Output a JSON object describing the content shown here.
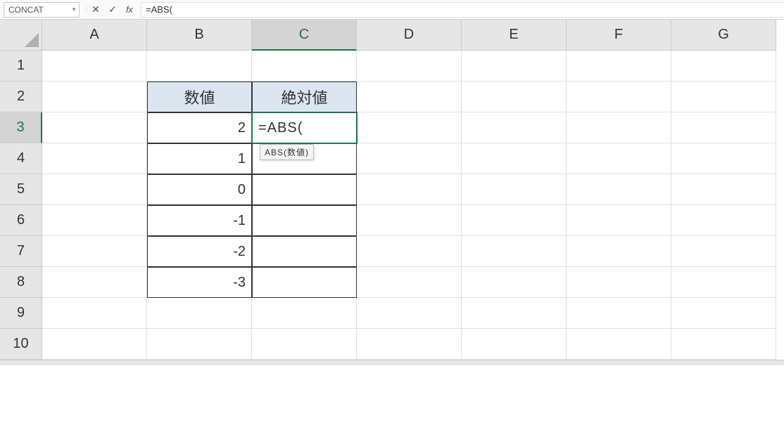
{
  "formula_bar": {
    "name_box": "CONCAT",
    "cancel_icon": "✕",
    "enter_icon": "✓",
    "fx_label": "fx",
    "formula": "=ABS("
  },
  "columns": [
    "A",
    "B",
    "C",
    "D",
    "E",
    "F",
    "G"
  ],
  "rows": [
    "1",
    "2",
    "3",
    "4",
    "5",
    "6",
    "7",
    "8",
    "9",
    "10"
  ],
  "headers": {
    "B2": "数値",
    "C2": "絶対値"
  },
  "values": {
    "B3": "2",
    "B4": "1",
    "B5": "0",
    "B6": "-1",
    "B7": "-2",
    "B8": "-3"
  },
  "editing_cell": {
    "ref": "C3",
    "text": "=ABS(",
    "tooltip": "ABS(数値)"
  },
  "active_col_index": 2,
  "active_row_index": 2
}
